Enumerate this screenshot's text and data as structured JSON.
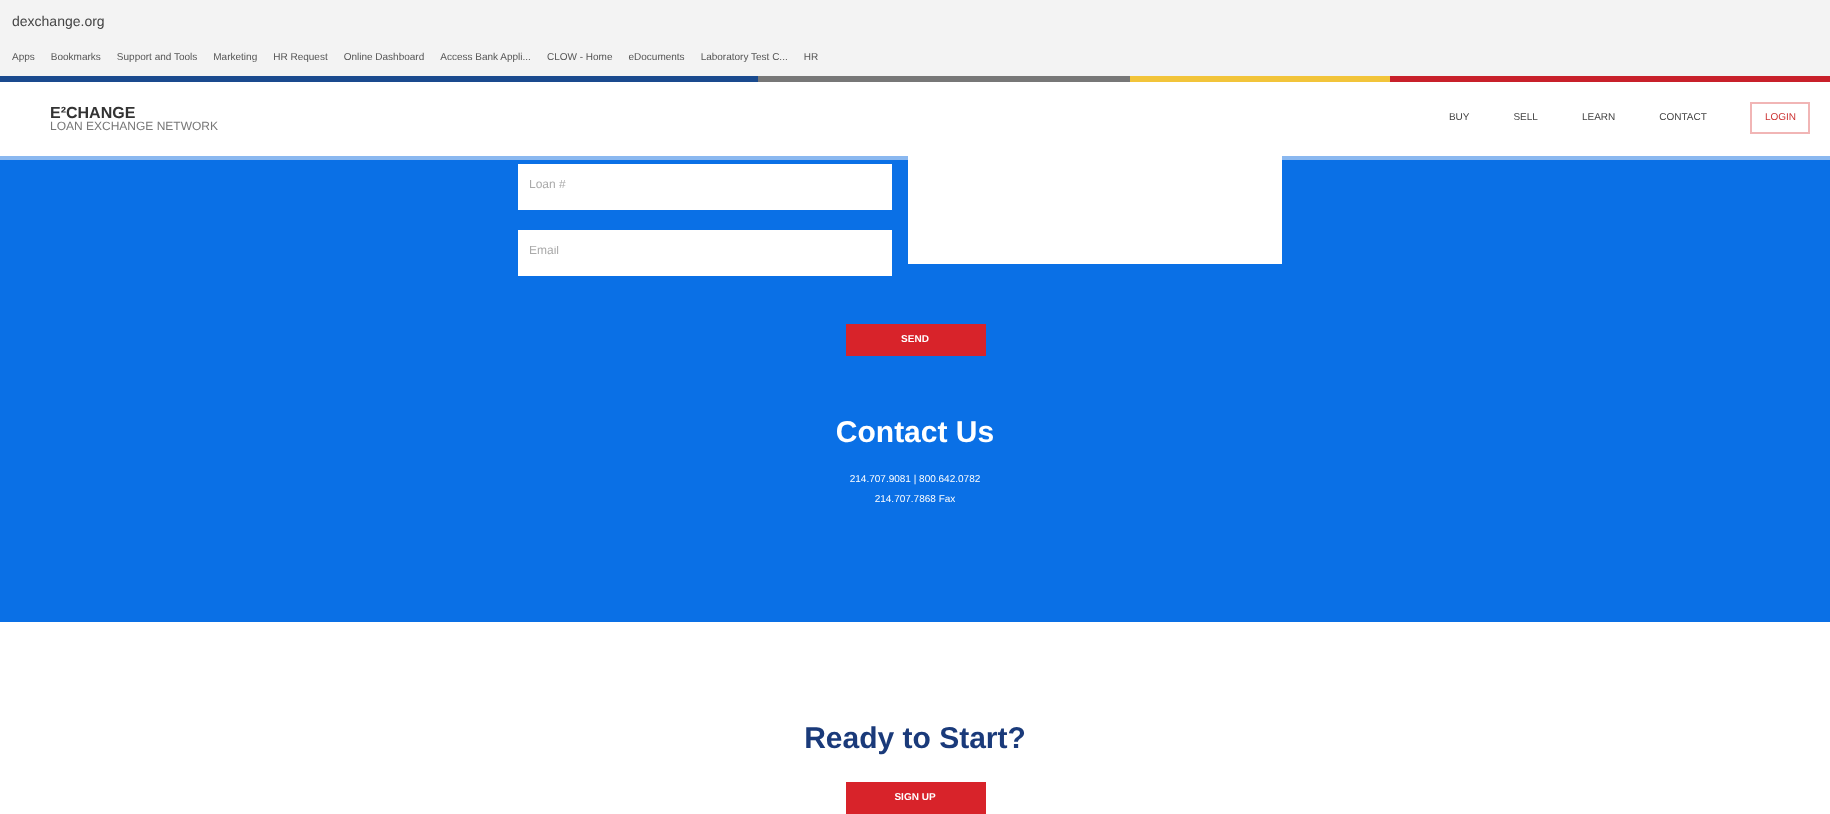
{
  "browser": {
    "url": "dexchange.org",
    "bookmarks": [
      "Apps",
      "Bookmarks",
      "Support and Tools",
      "Marketing",
      "HR Request",
      "Online Dashboard",
      "Access Bank Appli...",
      "CLOW - Home",
      "eDocuments",
      "Laboratory Test C...",
      "HR"
    ]
  },
  "site": {
    "logo": "E²CHANGE",
    "tagline": "LOAN EXCHANGE NETWORK",
    "nav": [
      {
        "label": "BUY",
        "kind": "link"
      },
      {
        "label": "SELL",
        "kind": "link"
      },
      {
        "label": "LEARN",
        "kind": "link"
      },
      {
        "label": "CONTACT",
        "kind": "link"
      },
      {
        "label": "LOGIN",
        "kind": "outlined"
      }
    ]
  },
  "form": {
    "fields": [
      {
        "placeholder": "Loan #"
      },
      {
        "placeholder": "Email"
      }
    ],
    "send": "SEND"
  },
  "contact": {
    "title": "Contact Us",
    "lines": [
      "214.707.9081 | 800.642.0782",
      "214.707.7868 Fax"
    ]
  },
  "cta": {
    "title": "Ready to Start?",
    "button": "SIGN UP"
  }
}
